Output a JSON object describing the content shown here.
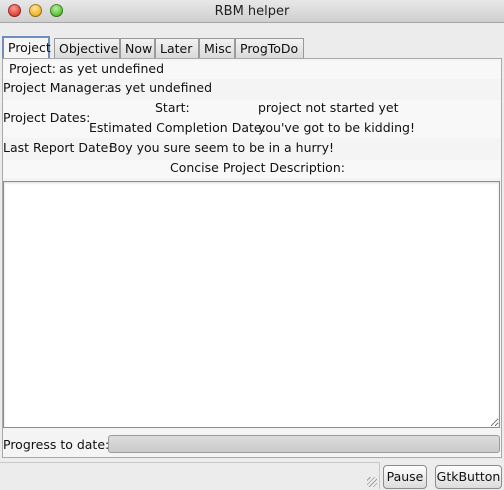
{
  "window": {
    "title": "RBM helper"
  },
  "tabs": [
    "Project",
    "Objective",
    "Now",
    "Later",
    "Misc",
    "ProgToDo"
  ],
  "project": {
    "project_label": "Project:",
    "project_value": "as yet undefined",
    "manager_label": "Project Manager:",
    "manager_value": "as yet undefined",
    "dates_label": "Project Dates:",
    "start_label": "Start:",
    "start_value": "project not started yet",
    "completion_label": "Estimated Completion Date:",
    "completion_value": "you've got to be kidding!",
    "last_report_label": "Last Report Date:",
    "last_report_value": "Boy you sure seem to be in a hurry!",
    "description_label": "Concise Project Description:",
    "description_value": "",
    "progress_label": "Progress to date:",
    "progress_value": 0
  },
  "buttons": {
    "pause": "Pause",
    "gtk": "GtkButton"
  },
  "colors": {
    "active_tab_border": "#6f8fb8",
    "close": "#e0443a",
    "minimize": "#f0b229",
    "maximize": "#5cc238"
  }
}
